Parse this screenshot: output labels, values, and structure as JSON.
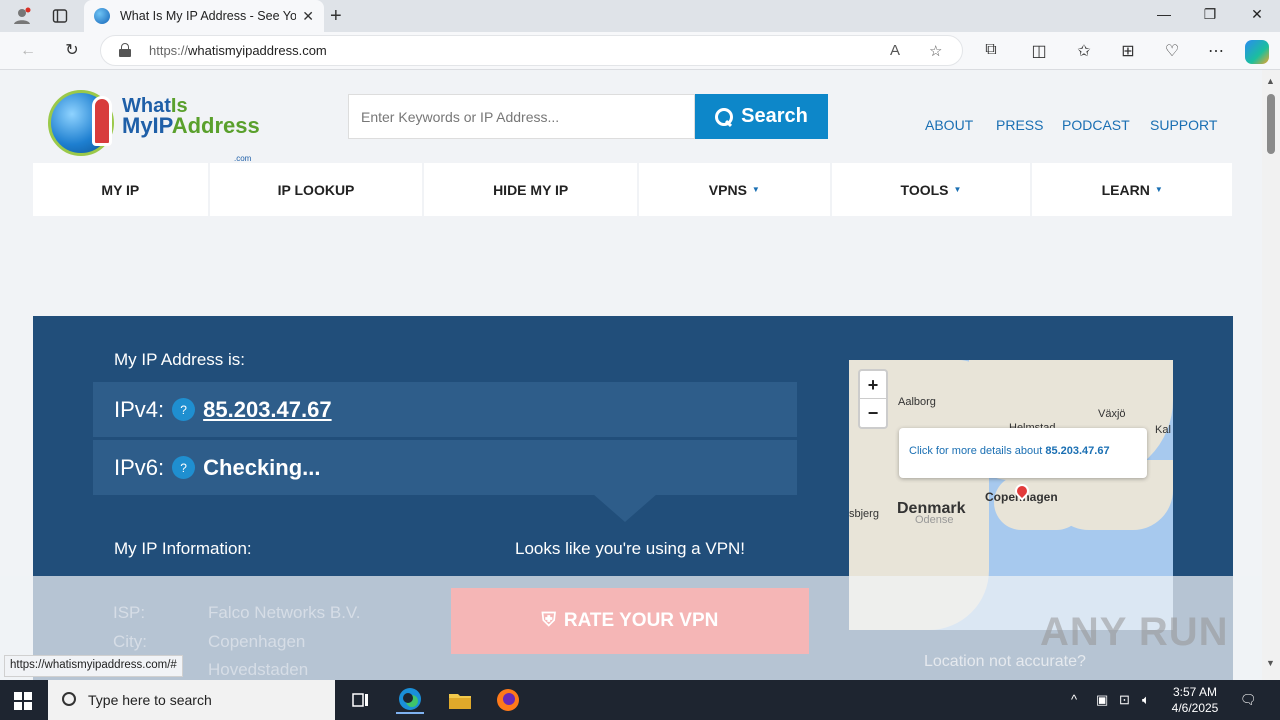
{
  "browser": {
    "tab_title": "What Is My IP Address - See Your",
    "url_prefix": "https://",
    "url_host": "whatismyipaddress.com",
    "status_url": "https://whatismyipaddress.com/#"
  },
  "site": {
    "logo_line1_a": "What",
    "logo_line1_b": "Is",
    "logo_line2_a": "MyIP",
    "logo_line2_b": "Address",
    "logo_com": ".com",
    "search_placeholder": "Enter Keywords or IP Address...",
    "search_label": "Search",
    "top_links": [
      "ABOUT",
      "PRESS",
      "PODCAST",
      "SUPPORT"
    ],
    "menu": [
      {
        "label": "MY IP",
        "dropdown": false
      },
      {
        "label": "IP LOOKUP",
        "dropdown": false
      },
      {
        "label": "HIDE MY IP",
        "dropdown": false
      },
      {
        "label": "VPNS",
        "dropdown": true
      },
      {
        "label": "TOOLS",
        "dropdown": true
      },
      {
        "label": "LEARN",
        "dropdown": true
      }
    ],
    "caret": "▼"
  },
  "hero": {
    "my_ip_label": "My IP Address is:",
    "ipv4_label": "IPv4:",
    "ipv4_value": "85.203.47.67",
    "ipv6_label": "IPv6:",
    "ipv6_value": "Checking...",
    "question": "?",
    "info_label": "My IP Information:",
    "vpn_notice": "Looks like you're using a VPN!",
    "vpn_button": "RATE YOUR VPN",
    "isp_label": "ISP:",
    "isp_value": "Falco Networks B.V.",
    "city_label": "City:",
    "city_value": "Copenhagen",
    "region_value": "Hovedstaden",
    "location_note": "Location not accurate?"
  },
  "map": {
    "labels": [
      "Aalborg",
      "Växjö",
      "Kal",
      "Helmstad",
      "Denmark",
      "Copenhagen",
      "sbjerg",
      "Odense"
    ],
    "popup_text": "Click for more details about",
    "popup_ip": "85.203.47.67",
    "zoom_in": "+",
    "zoom_out": "−"
  },
  "watermark": "ANY RUN",
  "taskbar": {
    "search_placeholder": "Type here to search",
    "time": "3:57 AM",
    "date": "4/6/2025"
  }
}
